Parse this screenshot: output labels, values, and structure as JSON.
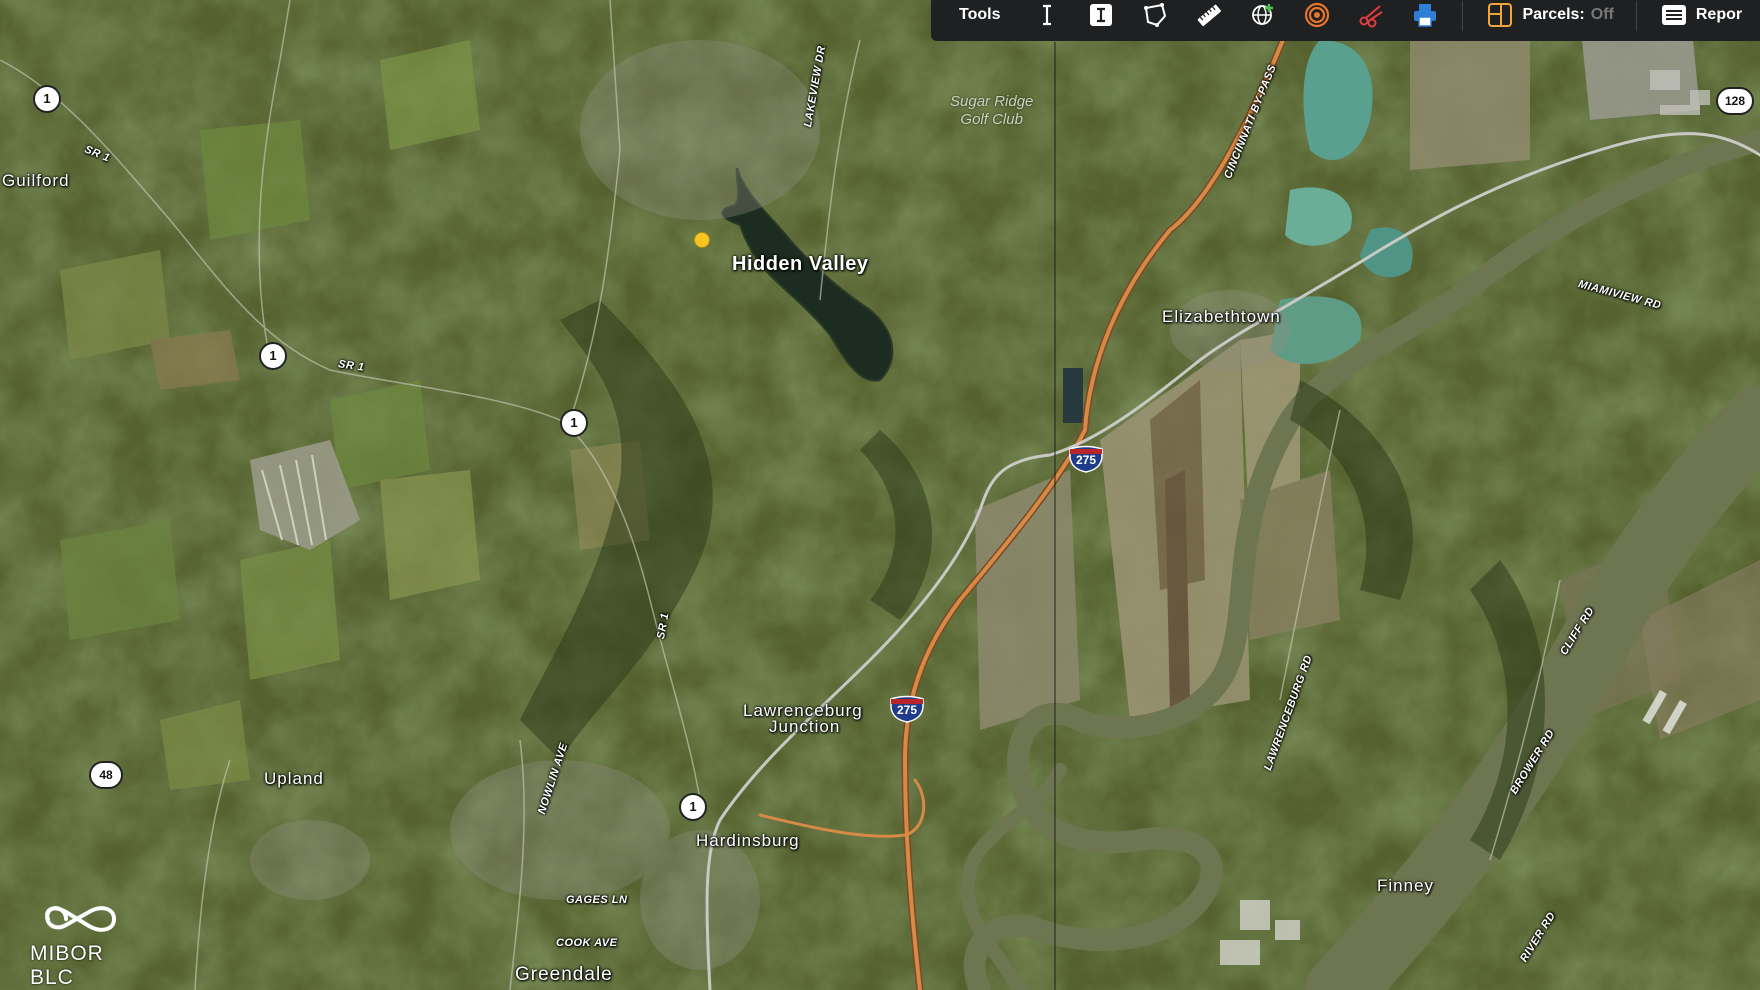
{
  "toolbar": {
    "tools_label": "Tools",
    "parcels_label": "Parcels:",
    "parcels_state": "Off",
    "report_label": "Repor",
    "tools": [
      {
        "name": "text-cursor-icon"
      },
      {
        "name": "text-box-icon"
      },
      {
        "name": "polygon-draw-icon"
      },
      {
        "name": "ruler-icon"
      },
      {
        "name": "globe-plus-icon"
      },
      {
        "name": "radius-rings-icon"
      },
      {
        "name": "scissors-icon"
      },
      {
        "name": "printer-icon"
      },
      {
        "name": "parcels-layer-icon"
      },
      {
        "name": "report-menu-icon"
      }
    ]
  },
  "map": {
    "places": {
      "hidden_valley": "Hidden Valley",
      "guilford": "Guilford",
      "elizabethtown": "Elizabethtown",
      "lawrenceburg_junction_1": "Lawrenceburg",
      "lawrenceburg_junction_2": "Junction",
      "hardinsburg": "Hardinsburg",
      "upland": "Upland",
      "greendale": "Greendale",
      "finney": "Finney"
    },
    "golf": {
      "line1": "Sugar Ridge",
      "line2": "Golf Club"
    },
    "roads": {
      "sr1_a": "SR 1",
      "sr1_b": "SR 1",
      "sr1_c": "SR 1",
      "lakeview": "LAKEVIEW DR",
      "cincinnati_bypass": "CINCINNATI BY-PASS",
      "miamiview": "MIAMIVIEW RD",
      "lawrenceburg_rd": "LAWRENCEBURG RD",
      "cliff_rd": "CLIFF RD",
      "brower_rd": "BROWER RD",
      "river_rd": "RIVER RD",
      "nowlin_ave": "NOWLIN AVE",
      "gages_ln": "GAGES LN",
      "cook_ave": "COOK AVE"
    },
    "shields": {
      "s1_a": "1",
      "s1_b": "1",
      "s1_c": "1",
      "s1_d": "1",
      "s48": "48",
      "s128": "128",
      "i275_a": "275",
      "i275_b": "275"
    }
  },
  "logo": {
    "text": "MIBOR BLC"
  },
  "colors": {
    "toolbar_bg": "#1e2022",
    "pin": "#f5c623",
    "interstate_road": "#d78a45",
    "river": "#6f7650",
    "lake": "#1c2c20"
  }
}
